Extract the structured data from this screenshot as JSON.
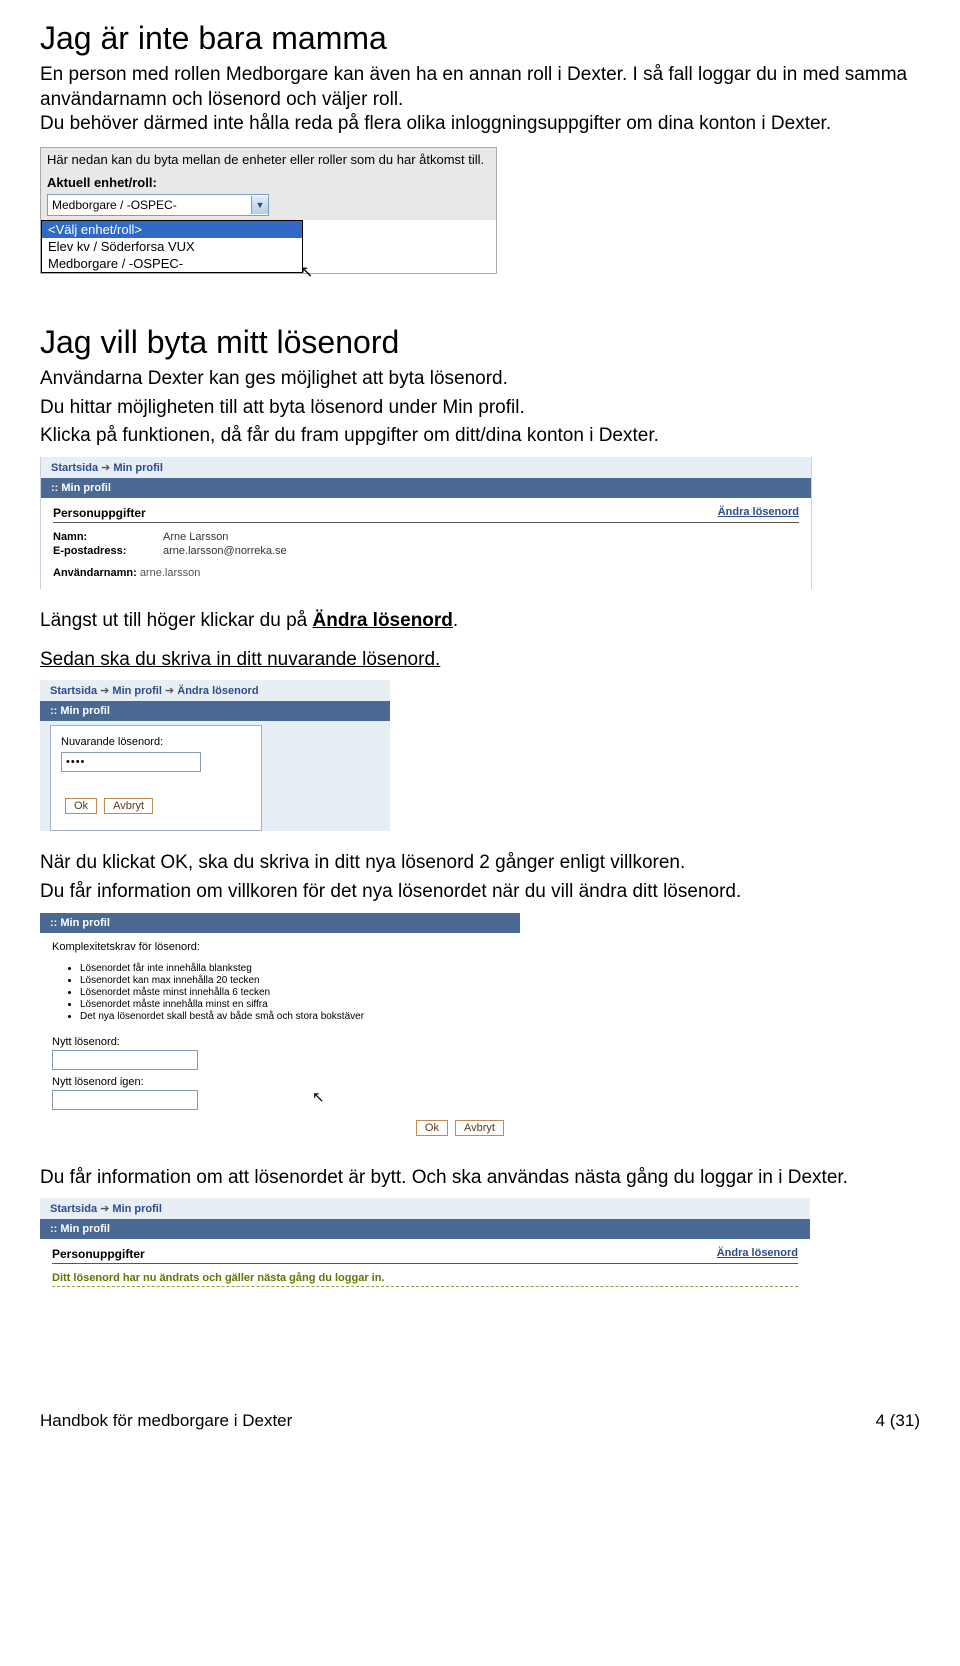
{
  "h1": "Jag är inte bara mamma",
  "intro": "En person med rollen Medborgare kan även ha en annan roll i Dexter. I så fall loggar du in med samma användarnamn och lösenord och väljer roll.\nDu behöver därmed inte hålla reda på flera olika inloggningsuppgifter om dina konton i Dexter.",
  "shot1": {
    "instr": "Här nedan kan du byta mellan de enheter eller roller som du har åtkomst till.",
    "label": "Aktuell enhet/roll:",
    "selected": "Medborgare / -OSPEC-",
    "options": [
      "<Välj enhet/roll>",
      "Elev kv / Söderforsa VUX",
      "Medborgare / -OSPEC-"
    ]
  },
  "h2": "Jag vill byta mitt lösenord",
  "p2a": "Användarna Dexter kan ges möjlighet att byta lösenord.",
  "p2b": "Du hittar möjligheten till att byta lösenord under Min profil.",
  "p2c": "Klicka på funktionen, då får du fram uppgifter om ditt/dina konton i Dexter.",
  "shot2": {
    "bc": [
      "Startsida",
      "Min profil"
    ],
    "panel": ":: Min profil",
    "sectionL": "Personuppgifter",
    "sectionR": "Ändra lösenord",
    "name_k": "Namn:",
    "name_v": "Arne Larsson",
    "mail_k": "E-postadress:",
    "mail_v": "arne.larsson@norreka.se",
    "user_k": "Användarnamn:",
    "user_v": "arne.larsson"
  },
  "p3_prefix": "Längst ut till höger klickar du på ",
  "p3_link": "Ändra lösenord",
  "p3_suffix": ".",
  "p4": "Sedan ska du skriva in ditt nuvarande lösenord.",
  "shot3": {
    "bc": [
      "Startsida",
      "Min profil",
      "Ändra lösenord"
    ],
    "panel": ":: Min profil",
    "label": "Nuvarande lösenord:",
    "val": "••••",
    "ok": "Ok",
    "cancel": "Avbryt"
  },
  "p5": "När du klickat OK, ska du skriva in ditt nya lösenord 2 gånger enligt villkoren.",
  "p6": "Du får information om villkoren för det nya lösenordet när du vill ändra ditt lösenord.",
  "shot4": {
    "panel": ":: Min profil",
    "ktitle": "Komplexitetskrav för lösenord:",
    "rules": [
      "Lösenordet får inte innehålla blanksteg",
      "Lösenordet kan max innehålla 20 tecken",
      "Lösenordet måste minst innehålla 6 tecken",
      "Lösenordet måste innehålla minst en siffra",
      "Det nya lösenordet skall bestå av både små och stora bokstäver"
    ],
    "l1": "Nytt lösenord:",
    "l2": "Nytt lösenord igen:",
    "ok": "Ok",
    "cancel": "Avbryt"
  },
  "p7": "Du får information om att lösenordet är bytt. Och ska användas nästa gång du loggar in i Dexter.",
  "shot5": {
    "bc": [
      "Startsida",
      "Min profil"
    ],
    "panel": ":: Min profil",
    "sectionL": "Personuppgifter",
    "sectionR": "Ändra lösenord",
    "confirm": "Ditt lösenord har nu ändrats och gäller nästa gång du loggar in."
  },
  "footerL": "Handbok för medborgare i Dexter",
  "footerR": "4 (31)"
}
